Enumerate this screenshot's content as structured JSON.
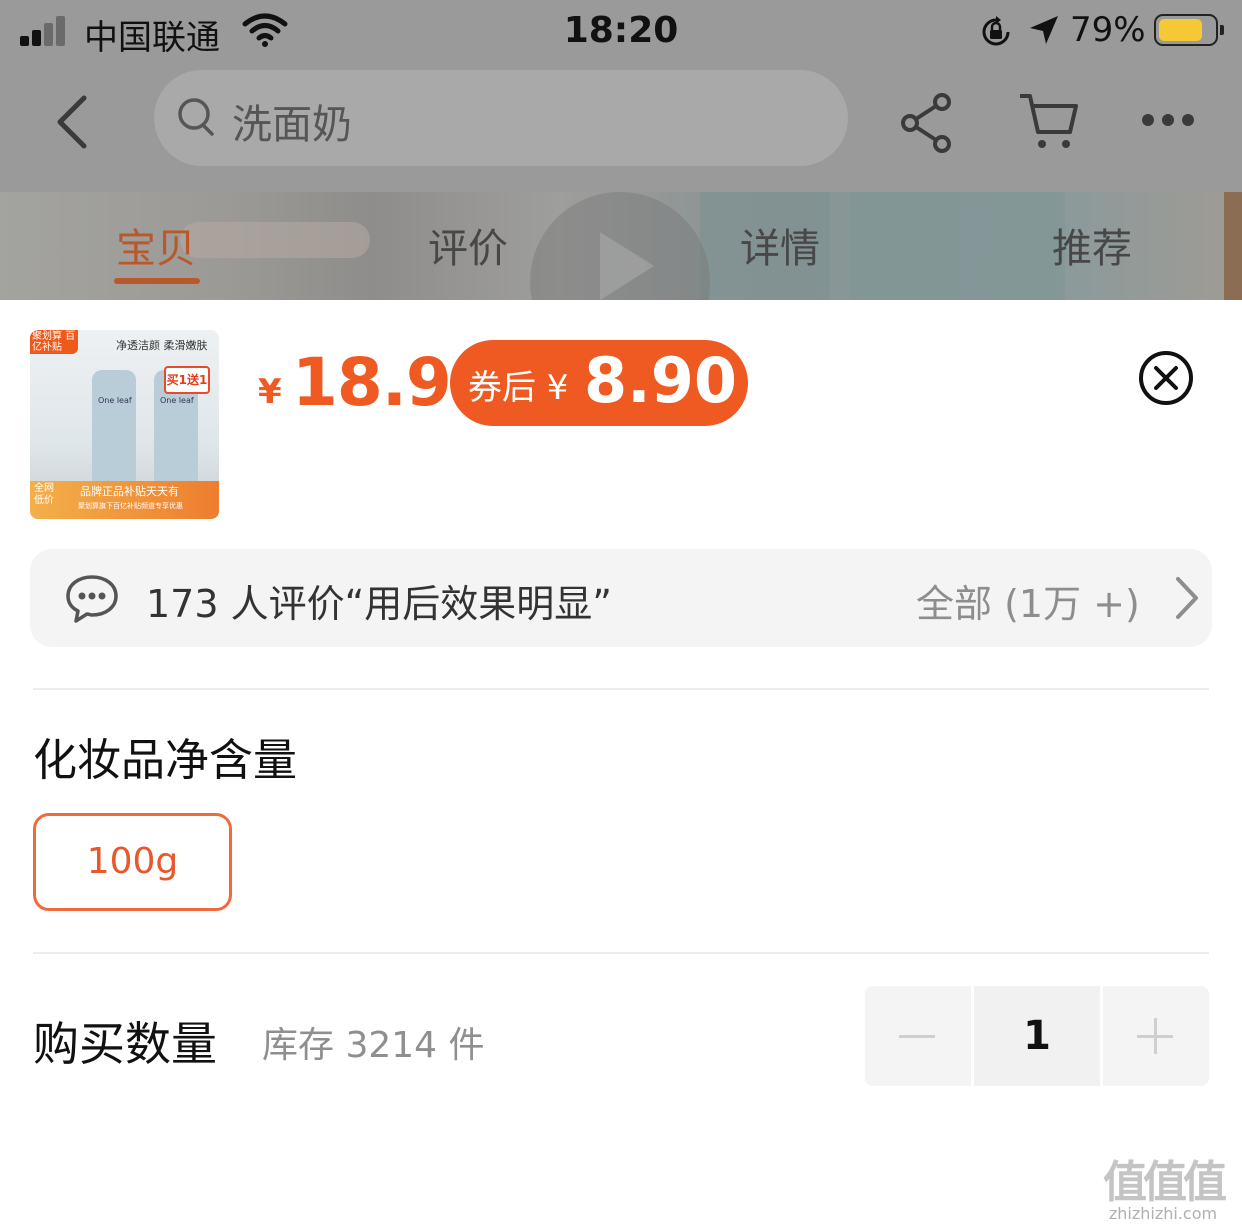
{
  "status_bar": {
    "carrier": "中国联通",
    "time": "18:20",
    "battery_percent": "79%",
    "battery_level": 0.79,
    "icons": [
      "signal-icon",
      "wifi-icon",
      "rotation-lock-icon",
      "location-icon",
      "battery-icon"
    ]
  },
  "nav": {
    "search_text": "洗面奶",
    "icons": [
      "back-icon",
      "search-icon",
      "share-icon",
      "cart-icon",
      "more-icon"
    ]
  },
  "tabs": [
    {
      "label": "宝贝",
      "active": true
    },
    {
      "label": "评价",
      "active": false
    },
    {
      "label": "详情",
      "active": false
    },
    {
      "label": "推荐",
      "active": false
    }
  ],
  "product": {
    "price_currency": "¥",
    "price": "18.9",
    "coupon_label": "券后 ¥",
    "coupon_price": "8.90",
    "thumb": {
      "badge": "聚划算 百亿补贴",
      "slogan": "净透洁颜 柔滑嫩肤",
      "brand": "One leaf",
      "promo": "买1送1",
      "corner": "全网 低价",
      "band_text": "品牌正品补贴天天有",
      "band_sub": "聚划算旗下百亿补贴频道专享优惠"
    }
  },
  "review": {
    "summary": "173 人评价“用后效果明显”",
    "all_label": "全部 (1万 +)"
  },
  "spec": {
    "title": "化妆品净含量",
    "options": [
      "100g"
    ],
    "selected": "100g"
  },
  "quantity": {
    "title": "购买数量",
    "stock": "库存 3214 件",
    "value": "1"
  },
  "watermark": {
    "logo": "值值值",
    "url": "zhizhizhi.com"
  },
  "colors": {
    "accent": "#ef5a22",
    "coupon_bg": "#ee5a22",
    "tab_active": "#b9582a",
    "overlay": "#9a9a9a"
  }
}
